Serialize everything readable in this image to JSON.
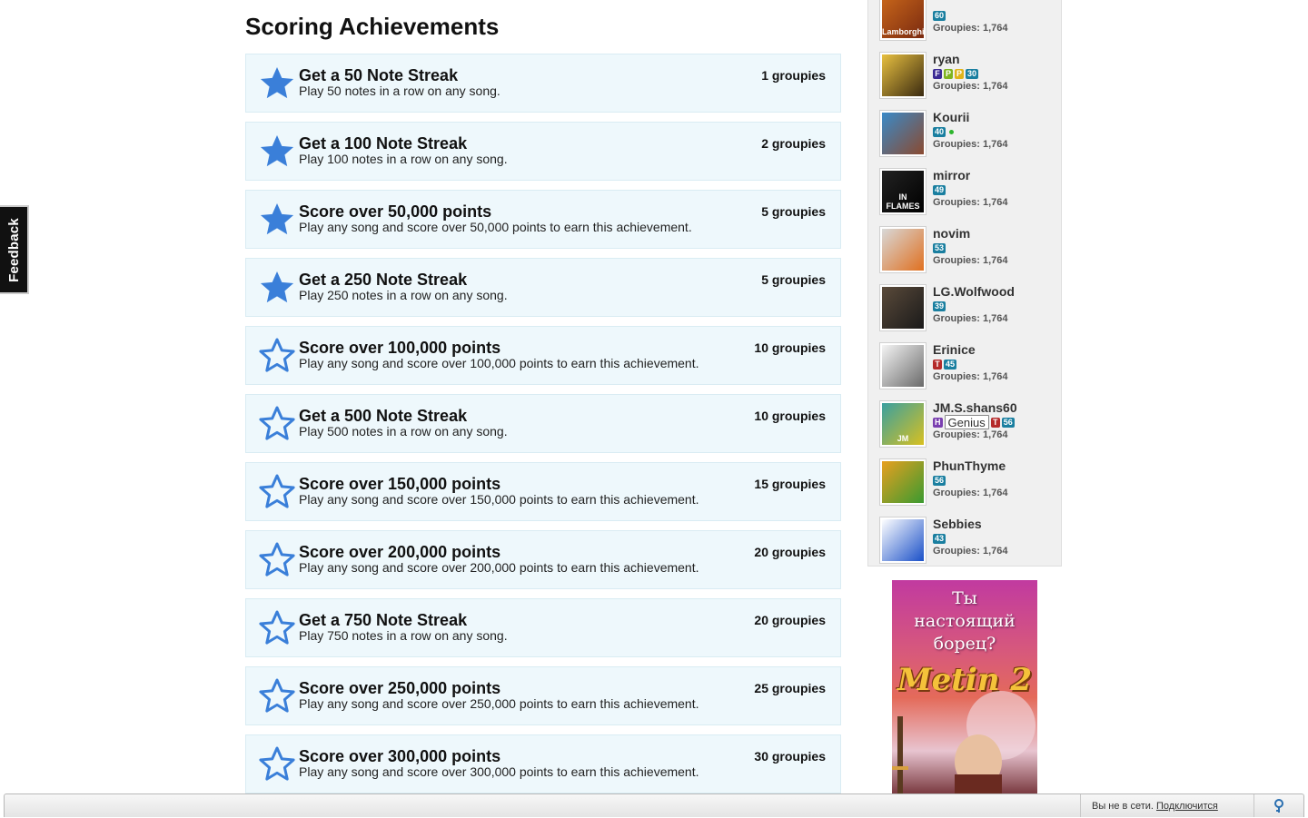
{
  "feedback": {
    "label": "Feedback"
  },
  "section": {
    "title": "Scoring Achievements"
  },
  "achievements": [
    {
      "title": "Get a 50 Note Streak",
      "desc": "Play 50 notes in a row on any song.",
      "reward": "1 groupies",
      "earned": true
    },
    {
      "title": "Get a 100 Note Streak",
      "desc": "Play 100 notes in a row on any song.",
      "reward": "2 groupies",
      "earned": true
    },
    {
      "title": "Score over 50,000 points",
      "desc": "Play any song and score over 50,000 points to earn this achievement.",
      "reward": "5 groupies",
      "earned": true
    },
    {
      "title": "Get a 250 Note Streak",
      "desc": "Play 250 notes in a row on any song.",
      "reward": "5 groupies",
      "earned": true
    },
    {
      "title": "Score over 100,000 points",
      "desc": "Play any song and score over 100,000 points to earn this achievement.",
      "reward": "10 groupies",
      "earned": false
    },
    {
      "title": "Get a 500 Note Streak",
      "desc": "Play 500 notes in a row on any song.",
      "reward": "10 groupies",
      "earned": false
    },
    {
      "title": "Score over 150,000 points",
      "desc": "Play any song and score over 150,000 points to earn this achievement.",
      "reward": "15 groupies",
      "earned": false
    },
    {
      "title": "Score over 200,000 points",
      "desc": "Play any song and score over 200,000 points to earn this achievement.",
      "reward": "20 groupies",
      "earned": false
    },
    {
      "title": "Get a 750 Note Streak",
      "desc": "Play 750 notes in a row on any song.",
      "reward": "20 groupies",
      "earned": false
    },
    {
      "title": "Score over 250,000 points",
      "desc": "Play any song and score over 250,000 points to earn this achievement.",
      "reward": "25 groupies",
      "earned": false
    },
    {
      "title": "Score over 300,000 points",
      "desc": "Play any song and score over 300,000 points to earn this achievement.",
      "reward": "30 groupies",
      "earned": false
    }
  ],
  "sidebar": {
    "users": [
      {
        "name": "",
        "avatar_text": "Lamborghi",
        "avatar_colors": [
          "#c8661a",
          "#7a2a10"
        ],
        "badges": [
          {
            "type": "level",
            "text": "60"
          }
        ],
        "online": false,
        "groupies": "Groupies: 1,764"
      },
      {
        "name": "ryan",
        "avatar_text": "",
        "avatar_colors": [
          "#e8c040",
          "#3a2a10"
        ],
        "badges": [
          {
            "type": "f",
            "text": "F"
          },
          {
            "type": "p",
            "text": "P"
          },
          {
            "type": "p2",
            "text": "P"
          },
          {
            "type": "level",
            "text": "30"
          }
        ],
        "online": false,
        "groupies": "Groupies: 1,764"
      },
      {
        "name": "Kourii",
        "avatar_text": "",
        "avatar_colors": [
          "#3a8ac8",
          "#8a4a30"
        ],
        "badges": [
          {
            "type": "level",
            "text": "40"
          }
        ],
        "online": true,
        "groupies": "Groupies: 1,764"
      },
      {
        "name": "mirror",
        "avatar_text": "IN FLAMES",
        "avatar_colors": [
          "#222222",
          "#000000"
        ],
        "badges": [
          {
            "type": "level",
            "text": "49"
          }
        ],
        "online": false,
        "groupies": "Groupies: 1,764"
      },
      {
        "name": "novim",
        "avatar_text": "",
        "avatar_colors": [
          "#d8d8d8",
          "#e07020"
        ],
        "badges": [
          {
            "type": "level",
            "text": "53"
          }
        ],
        "online": false,
        "groupies": "Groupies: 1,764"
      },
      {
        "name": "LG.Wolfwood",
        "avatar_text": "",
        "avatar_colors": [
          "#5a4a3a",
          "#1a1a1a"
        ],
        "badges": [
          {
            "type": "level",
            "text": "39"
          }
        ],
        "online": false,
        "groupies": "Groupies: 1,764"
      },
      {
        "name": "Erinice",
        "avatar_text": "",
        "avatar_colors": [
          "#f4f4f4",
          "#6a6a6a"
        ],
        "badges": [
          {
            "type": "t",
            "text": "T"
          },
          {
            "type": "level",
            "text": "45"
          }
        ],
        "online": false,
        "groupies": "Groupies: 1,764"
      },
      {
        "name": "JM.S.shans60",
        "avatar_text": "JM",
        "avatar_colors": [
          "#3aa0a0",
          "#d8c020"
        ],
        "badges": [
          {
            "type": "h",
            "text": "H"
          },
          {
            "type": "genius",
            "text": "Genius"
          },
          {
            "type": "t",
            "text": "T"
          },
          {
            "type": "level",
            "text": "56"
          }
        ],
        "online": false,
        "groupies": "Groupies: 1,764"
      },
      {
        "name": "PhunThyme",
        "avatar_text": "",
        "avatar_colors": [
          "#e8a020",
          "#3a9a30"
        ],
        "badges": [
          {
            "type": "level",
            "text": "56"
          }
        ],
        "online": false,
        "groupies": "Groupies: 1,764"
      },
      {
        "name": "Sebbies",
        "avatar_text": "",
        "avatar_colors": [
          "#ffffff",
          "#1a50c8"
        ],
        "badges": [
          {
            "type": "level",
            "text": "43"
          }
        ],
        "online": false,
        "groupies": "Groupies: 1,764"
      }
    ]
  },
  "ad": {
    "text_lines": [
      "Ты",
      "настоящий",
      "борец?"
    ],
    "logo": "Metin 2"
  },
  "chat": {
    "status_text": "Вы не в сети.",
    "connect_link": "Подключится"
  },
  "colors": {
    "star_fill": "#3a7fd9",
    "card_bg": "#eef8fc",
    "level_badge": "#1a7fa0"
  }
}
